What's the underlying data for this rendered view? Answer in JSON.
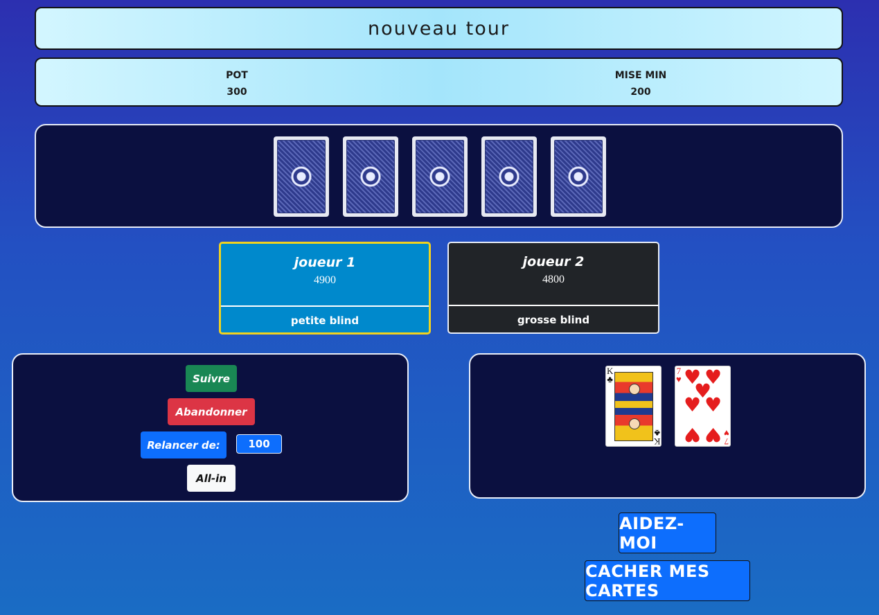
{
  "header": {
    "title": "nouveau tour"
  },
  "stats": {
    "pot_label": "POT",
    "pot_value": "300",
    "mise_label": "MISE MIN",
    "mise_value": "200"
  },
  "board": {
    "cards": [
      "card-back",
      "card-back",
      "card-back",
      "card-back",
      "card-back"
    ]
  },
  "players": [
    {
      "name": "joueur 1",
      "chips": "4900",
      "role": "petite blind",
      "active": true
    },
    {
      "name": "joueur 2",
      "chips": "4800",
      "role": "grosse blind",
      "active": false
    }
  ],
  "actions": {
    "call_label": "Suivre",
    "fold_label": "Abandonner",
    "raise_label": "Relancer de:",
    "raise_value": "100",
    "allin_label": "All-in"
  },
  "hand": {
    "cards": [
      {
        "rank": "K",
        "suit": "♣",
        "color": "#111111"
      },
      {
        "rank": "7",
        "suit": "♥",
        "color": "#e51d1d"
      }
    ]
  },
  "buttons": {
    "help_label": "AIDEZ-MOI",
    "hide_label": "CACHER MES CARTES"
  },
  "colors": {
    "call": "#198754",
    "fold": "#dc3545",
    "raise": "#0d6efd",
    "allin": "#f8f9fa",
    "active_player": "#0089cc",
    "inactive_player": "#212428",
    "active_border": "#f2d21e",
    "panel": "#0b1040"
  }
}
